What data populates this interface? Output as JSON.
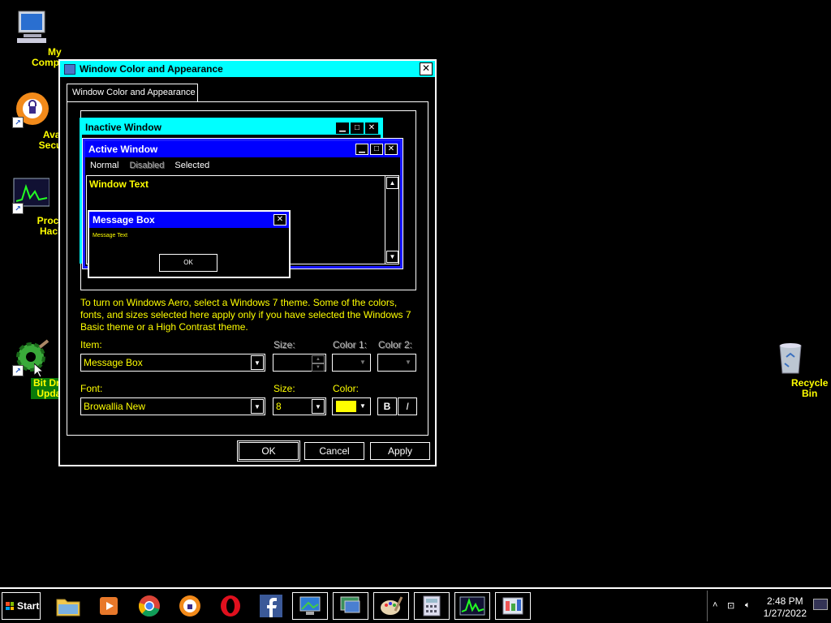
{
  "desktop": {
    "icons": [
      {
        "label": "My Computer"
      },
      {
        "label": "Avast Secur..."
      },
      {
        "label": "Process Hacker"
      },
      {
        "label": "Bit Driver Updater"
      },
      {
        "label": "Recycle Bin"
      }
    ]
  },
  "dialog": {
    "title": "Window Color and Appearance",
    "close_label": "✕",
    "tab_label": "Window Color and Appearance",
    "preview": {
      "inactive_title": "Inactive Window",
      "active_title": "Active Window",
      "menu_normal": "Normal",
      "menu_disabled": "Disabled",
      "menu_selected": "Selected",
      "window_text": "Window Text",
      "msgbox_title": "Message Box",
      "msgbox_text": "Message Text",
      "msgbox_ok": "OK"
    },
    "info_text": "To turn on Windows Aero, select a Windows 7 theme.  Some of the colors, fonts, and sizes selected here apply only if you have selected the Windows 7 Basic theme or a High Contrast theme.",
    "item_label": "Item:",
    "item_value": "Message Box",
    "item_size_label": "Size:",
    "color1_label": "Color 1:",
    "color2_label": "Color 2:",
    "font_label": "Font:",
    "font_value": "Browallia New",
    "font_size_label": "Size:",
    "font_size_value": "8",
    "font_color_label": "Color:",
    "font_color": "#ffff00",
    "bold_label": "B",
    "italic_label": "I",
    "ok_label": "OK",
    "cancel_label": "Cancel",
    "apply_label": "Apply"
  },
  "taskbar": {
    "start_label": "Start",
    "apps": [
      "file-explorer-icon",
      "media-player-icon",
      "chrome-icon",
      "avast-icon",
      "opera-icon",
      "facebook-icon",
      "display-settings-icon",
      "remote-desktop-icon",
      "paint-icon",
      "calculator-icon",
      "process-hacker-icon",
      "control-panel-icon"
    ],
    "time": "2:48 PM",
    "date": "1/27/2022"
  },
  "colors": {
    "title_cyan": "#00ffff",
    "active_blue": "#0000ff",
    "highlight_yellow": "#ffff00"
  }
}
